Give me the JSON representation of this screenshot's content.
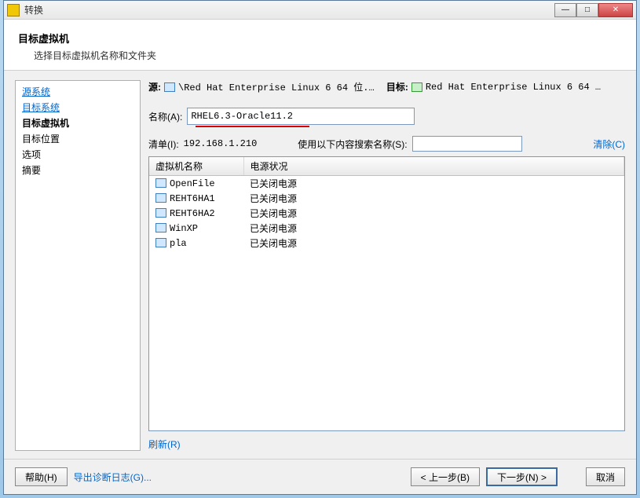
{
  "window": {
    "title": "转换"
  },
  "header": {
    "title": "目标虚拟机",
    "subtitle": "选择目标虚拟机名称和文件夹"
  },
  "sidebar": {
    "items": [
      {
        "label": "源系统",
        "kind": "link"
      },
      {
        "label": "目标系统",
        "kind": "link"
      },
      {
        "label": "目标虚拟机",
        "kind": "current"
      },
      {
        "label": "目标位置",
        "kind": "plain"
      },
      {
        "label": "选项",
        "kind": "plain"
      },
      {
        "label": "摘要",
        "kind": "plain"
      }
    ]
  },
  "source_bar": {
    "source_label": "源:",
    "source_text": "\\Red Hat Enterprise Linux 6 64 位.…",
    "target_label": "目标:",
    "target_text": "Red Hat Enterprise Linux 6 64 …"
  },
  "form": {
    "name_label": "名称(A):",
    "name_value": "RHEL6.3-Oracle11.2",
    "list_label": "清单(I):",
    "list_value": "192.168.1.210",
    "search_label": "使用以下内容搜索名称(S):",
    "search_value": "",
    "clear_label": "清除(C)"
  },
  "table": {
    "columns": [
      "虚拟机名称",
      "电源状况"
    ],
    "rows": [
      {
        "name": "OpenFile",
        "power": "已关闭电源"
      },
      {
        "name": "REHT6HA1",
        "power": "已关闭电源"
      },
      {
        "name": "REHT6HA2",
        "power": "已关闭电源"
      },
      {
        "name": "WinXP",
        "power": "已关闭电源"
      },
      {
        "name": "pla",
        "power": "已关闭电源"
      }
    ]
  },
  "links": {
    "refresh": "刷新(R)"
  },
  "footer": {
    "help": "帮助(H)",
    "export": "导出诊断日志(G)...",
    "back": "< 上一步(B)",
    "next": "下一步(N) >",
    "cancel": "取消"
  }
}
